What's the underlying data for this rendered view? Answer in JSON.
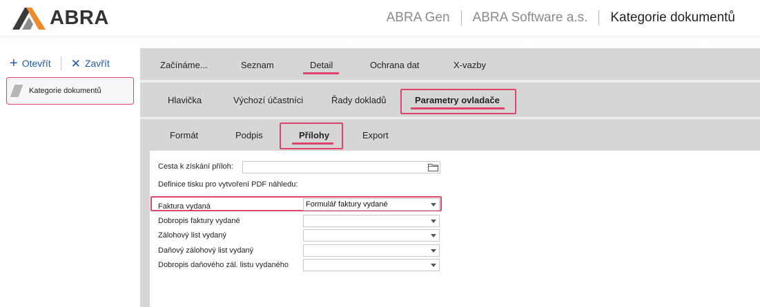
{
  "header": {
    "logo_text": "ABRA",
    "product": "ABRA Gen",
    "company": "ABRA Software a.s.",
    "page_title": "Kategorie dokumentů"
  },
  "left": {
    "open_label": "Otevřít",
    "close_label": "Zavřít",
    "item_label": "Kategorie dokumentů"
  },
  "tabs1": [
    {
      "label": "Začínáme..."
    },
    {
      "label": "Seznam"
    },
    {
      "label": "Detail",
      "active": true
    },
    {
      "label": "Ochrana dat"
    },
    {
      "label": "X-vazby"
    }
  ],
  "tabs2": [
    {
      "label": "Hlavička"
    },
    {
      "label": "Výchozí účastníci"
    },
    {
      "label": "Řady dokladů"
    },
    {
      "label": "Parametry ovladače",
      "active": true
    }
  ],
  "tabs3": [
    {
      "label": "Formát"
    },
    {
      "label": "Podpis"
    },
    {
      "label": "Přílohy",
      "active": true
    },
    {
      "label": "Export"
    }
  ],
  "form": {
    "path_label": "Cesta k získání příloh:",
    "path_value": "",
    "print_def_label": "Definice tisku pro vytvoření PDF náhledu:",
    "rows": [
      {
        "label": "Faktura vydaná",
        "value": "Formulář faktury vydané"
      },
      {
        "label": "Dobropis faktury vydané",
        "value": ""
      },
      {
        "label": "Zálohový list vydaný",
        "value": ""
      },
      {
        "label": "Daňový zálohový list vydaný",
        "value": ""
      },
      {
        "label": "Dobropis daňového zál. listu vydaného",
        "value": ""
      }
    ]
  },
  "colors": {
    "accent": "#e0436a",
    "link": "#1e5aa8",
    "tabbar": "#d6d6d6"
  }
}
